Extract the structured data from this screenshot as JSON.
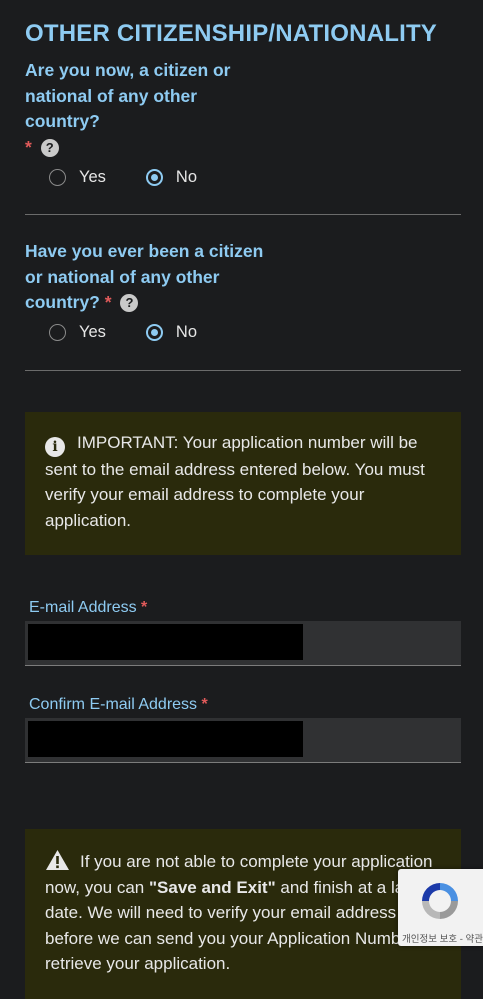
{
  "section": {
    "title": "OTHER CITIZENSHIP/NATIONALITY"
  },
  "question1": {
    "text": "Are you now, a citizen or national of any other country?",
    "required_marker": "*",
    "help_icon": "question-circle-icon",
    "options": [
      {
        "label": "Yes",
        "selected": false
      },
      {
        "label": "No",
        "selected": true
      }
    ]
  },
  "question2": {
    "text": "Have you ever been a citizen or national of any other country?",
    "required_marker": "*",
    "help_icon": "question-circle-icon",
    "options": [
      {
        "label": "Yes",
        "selected": false
      },
      {
        "label": "No",
        "selected": true
      }
    ]
  },
  "important_notice": {
    "icon": "info-circle-icon",
    "text": "IMPORTANT: Your application number will be sent to the email address entered below. You must verify your email address to complete your application."
  },
  "email": {
    "label": "E-mail Address",
    "required_marker": "*",
    "value": ""
  },
  "confirm_email": {
    "label": "Confirm E-mail Address",
    "required_marker": "*",
    "value": ""
  },
  "save_notice": {
    "icon": "warning-triangle-icon",
    "text_before": "If you are not able to complete your application now, you can ",
    "bold": "\"Save and Exit\"",
    "text_after": " and finish at a later date. We will need to verify your email address before we can send you your Application Number to retrieve your application."
  },
  "recaptcha": {
    "text": "개인정보 보호 - 약관",
    "icon": "recaptcha-logo-icon"
  },
  "colors": {
    "background": "#1b1c1e",
    "accent": "#8ecbf2",
    "required": "#e05a5a",
    "notice_background": "#2a2a0c",
    "field_background": "#303133"
  }
}
